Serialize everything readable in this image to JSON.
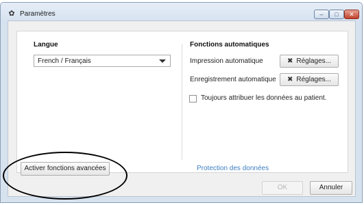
{
  "window": {
    "title": "Paramètres",
    "controls": {
      "minimize": "–",
      "maximize": "□",
      "close": "✕"
    }
  },
  "language": {
    "label": "Langue",
    "selected": "French / Français"
  },
  "auto": {
    "heading": "Fonctions automatiques",
    "print_label": "Impression automatique",
    "save_label": "Enregistrement automatique",
    "settings_button": "Réglages...",
    "settings_icon": "✖",
    "assign_checkbox_label": "Toujours attribuer les données au patient.",
    "assign_checked": false
  },
  "advanced_button": "Activer fonctions avancées",
  "data_protection_link": "Protection des données",
  "footer": {
    "ok": "OK",
    "cancel": "Annuler"
  },
  "colors": {
    "link": "#3d7fc1",
    "close_button": "#c1412a",
    "annotation": "#000000"
  }
}
